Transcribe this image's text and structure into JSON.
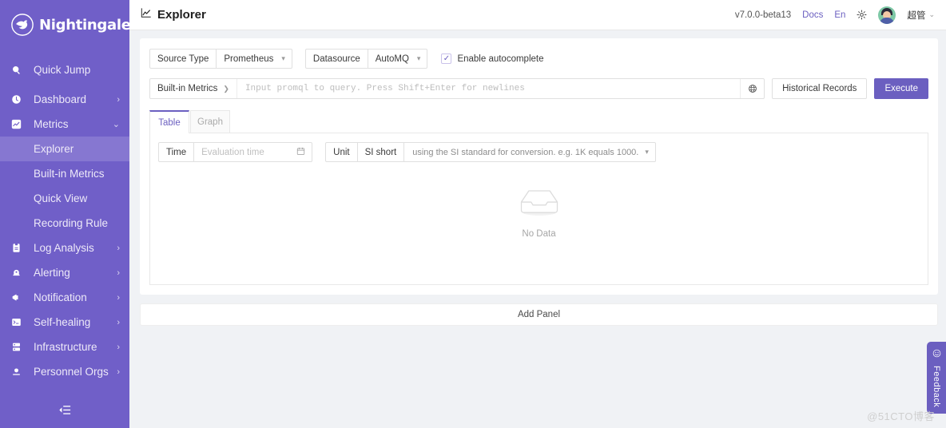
{
  "brand": {
    "name": "Nightingale",
    "logo_icon": "dove-logo-icon",
    "sidebar_color": "#705fc8",
    "accent_color": "#6b5fc0"
  },
  "sidebar": {
    "quick_jump": {
      "label": "Quick Jump",
      "icon": "search-icon"
    },
    "items": [
      {
        "label": "Dashboard",
        "icon": "dashboard-icon",
        "arrow": "›",
        "expanded": false
      },
      {
        "label": "Metrics",
        "icon": "metrics-icon",
        "arrow": "⌄",
        "expanded": true
      },
      {
        "label": "Log Analysis",
        "icon": "log-analysis-icon",
        "arrow": "›",
        "expanded": false
      },
      {
        "label": "Alerting",
        "icon": "alerting-icon",
        "arrow": "›",
        "expanded": false
      },
      {
        "label": "Notification",
        "icon": "notification-icon",
        "arrow": "›",
        "expanded": false
      },
      {
        "label": "Self-healing",
        "icon": "terminal-icon",
        "arrow": "›",
        "expanded": false
      },
      {
        "label": "Infrastructure",
        "icon": "infrastructure-icon",
        "arrow": "›",
        "expanded": false
      },
      {
        "label": "Personnel Orgs",
        "icon": "user-icon",
        "arrow": "›",
        "expanded": false
      }
    ],
    "metrics_children": [
      {
        "label": "Explorer",
        "active": true
      },
      {
        "label": "Built-in Metrics",
        "active": false
      },
      {
        "label": "Quick View",
        "active": false
      },
      {
        "label": "Recording Rule",
        "active": false
      }
    ],
    "collapse_icon": "collapse-sidebar-icon"
  },
  "topbar": {
    "title": "Explorer",
    "title_icon": "chart-line-icon",
    "version": "v7.0.0-beta13",
    "docs_label": "Docs",
    "lang_label": "En",
    "settings_icon": "gear-icon",
    "avatar_icon": "user-avatar",
    "username": "超管",
    "user_chevron": "⌄"
  },
  "query_bar": {
    "source_type_label": "Source Type",
    "source_type_value": "Prometheus",
    "datasource_label": "Datasource",
    "datasource_value": "AutoMQ",
    "autocomplete_label": "Enable autocomplete",
    "autocomplete_checked": true,
    "metrics_picker_label": "Built-in Metrics",
    "metrics_picker_arrow": "❯",
    "promql_value": "",
    "promql_placeholder": "Input promql to query. Press Shift+Enter for newlines",
    "globe_icon": "globe-icon",
    "historical_records_label": "Historical Records",
    "execute_label": "Execute"
  },
  "tabs": [
    {
      "label": "Table",
      "active": true
    },
    {
      "label": "Graph",
      "active": false
    }
  ],
  "panel": {
    "time_label": "Time",
    "time_value": "",
    "time_placeholder": "Evaluation time",
    "calendar_icon": "calendar-icon",
    "unit_label": "Unit",
    "unit_value": "SI short",
    "unit_hint": "using the SI standard for conversion. e.g. 1K equals 1000.",
    "unit_chevron": "⌄",
    "empty_icon": "empty-inbox-icon",
    "empty_text": "No Data"
  },
  "add_panel_label": "Add Panel",
  "feedback": {
    "label": "Feedback",
    "icon": "smiley-icon"
  },
  "watermark": "@51CTO博客"
}
